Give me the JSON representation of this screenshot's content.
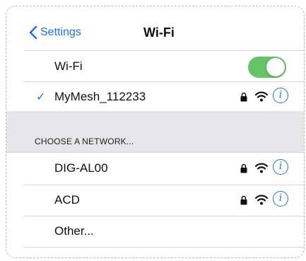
{
  "nav": {
    "back_label": "Settings",
    "title": "Wi-Fi"
  },
  "wifi_toggle": {
    "label": "Wi-Fi",
    "on": true,
    "color": "#65c466"
  },
  "connected": {
    "name": "MyMesh_112233",
    "secured": true,
    "icons": [
      "checkmark-icon",
      "lock-icon",
      "wifi-icon",
      "info-icon"
    ]
  },
  "section_header": "CHOOSE A NETWORK...",
  "networks": [
    {
      "name": "DIG-AL00",
      "secured": true
    },
    {
      "name": "ACD",
      "secured": true
    }
  ],
  "other_label": "Other...",
  "info_glyph": "i",
  "check_glyph": "✓",
  "accent_color": "#1a73e8"
}
